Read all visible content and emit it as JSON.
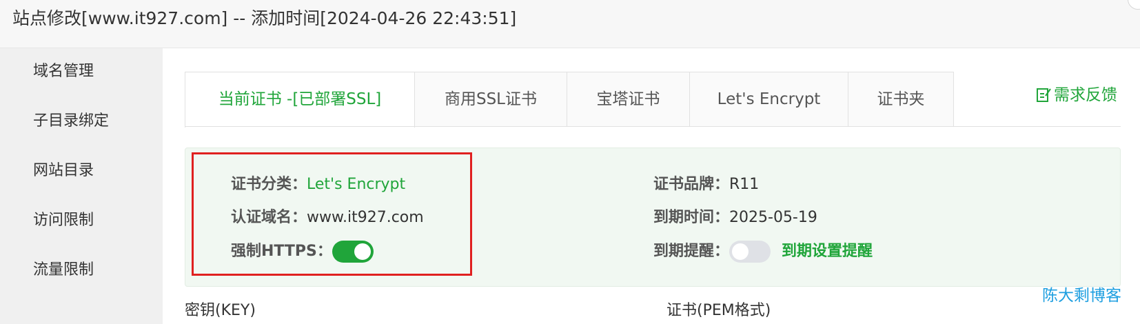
{
  "window": {
    "title": "站点修改[www.it927.com] -- 添加时间[2024-04-26 22:43:51]"
  },
  "sidebar": {
    "items": [
      {
        "label": "域名管理"
      },
      {
        "label": "子目录绑定"
      },
      {
        "label": "网站目录"
      },
      {
        "label": "访问限制"
      },
      {
        "label": "流量限制"
      }
    ]
  },
  "tabs": [
    {
      "label": "当前证书 -[已部署SSL]",
      "active": true
    },
    {
      "label": "商用SSL证书",
      "active": false
    },
    {
      "label": "宝塔证书",
      "active": false
    },
    {
      "label": "Let's Encrypt",
      "active": false
    },
    {
      "label": "证书夹",
      "active": false
    }
  ],
  "feedback": {
    "label": "需求反馈",
    "icon": "edit-icon"
  },
  "cert_info": {
    "category_label": "证书分类：",
    "category_value": "Let's Encrypt",
    "domain_label": "认证域名：",
    "domain_value": "www.it927.com",
    "force_https_label": "强制HTTPS：",
    "force_https_on": true,
    "brand_label": "证书品牌：",
    "brand_value": "R11",
    "expire_label": "到期时间：",
    "expire_value": "2025-05-19",
    "reminder_label": "到期提醒：",
    "reminder_on": false,
    "reminder_link": "到期设置提醒"
  },
  "fields": {
    "key_label": "密钥(KEY)",
    "pem_label": "证书(PEM格式)"
  },
  "watermark": "陈大剩博客",
  "colors": {
    "accent": "#20a53a",
    "highlight_border": "#e02020",
    "watermark": "#1e9fe0",
    "panel_bg": "#f1f8f2"
  }
}
